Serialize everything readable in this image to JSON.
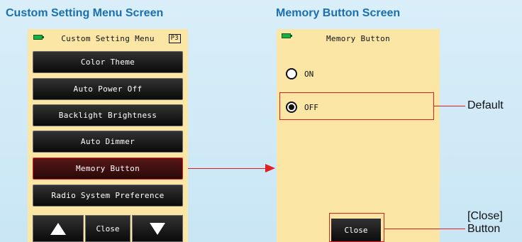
{
  "left": {
    "caption": "Custom Setting Menu Screen",
    "header_title": "Custom Setting Menu",
    "page_badge": "P3",
    "menu_items": [
      {
        "label": "Color Theme"
      },
      {
        "label": "Auto Power Off"
      },
      {
        "label": "Backlight Brightness"
      },
      {
        "label": "Auto Dimmer"
      },
      {
        "label": "Memory Button"
      },
      {
        "label": "Radio System Preference"
      }
    ],
    "close_label": "Close"
  },
  "right": {
    "caption": "Memory Button Screen",
    "header_title": "Memory Button",
    "options": [
      {
        "label": "ON",
        "selected": false
      },
      {
        "label": "OFF",
        "selected": true
      }
    ],
    "close_label": "Close"
  },
  "callouts": {
    "default": "Default",
    "close_line1": "[Close]",
    "close_line2": "Button"
  },
  "colors": {
    "screen_bg": "#fbe6a6",
    "caption": "#1a6fb3",
    "highlight": "#e02020",
    "button": "#111111"
  }
}
